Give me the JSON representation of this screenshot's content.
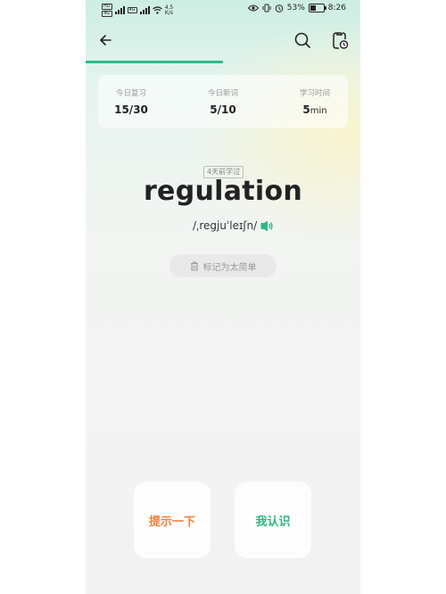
{
  "status_bar": {
    "sim1": [
      "HD",
      "4G"
    ],
    "sim2": [
      "4G"
    ],
    "speed": [
      "4.5",
      "K/s"
    ],
    "battery": "53%",
    "battery_level": 0.53,
    "time": "8:26"
  },
  "nav": {
    "back_icon": "arrow-left-icon",
    "search_icon": "search-icon",
    "task_icon": "task-clock-icon"
  },
  "progress": {
    "fraction": 0.5,
    "color": "#2dbd8c"
  },
  "stats": {
    "review": {
      "label": "今日复习",
      "value": "15/30"
    },
    "new": {
      "label": "今日新词",
      "value": "5/10"
    },
    "time": {
      "label": "学习时间",
      "value": "5",
      "unit": "min"
    }
  },
  "word": {
    "tag": "4天前学过",
    "text": "regulation",
    "phonetic": "/ˌregjuˈleɪʃn/",
    "speaker_icon": "speaker-icon",
    "speaker_color": "#2db87f"
  },
  "mark_button": {
    "label": "标记为太简单",
    "icon": "trash-icon"
  },
  "actions": {
    "hint": {
      "label": "提示一下",
      "color": "#f07f3a"
    },
    "know": {
      "label": "我认识",
      "color": "#2db87f"
    }
  }
}
